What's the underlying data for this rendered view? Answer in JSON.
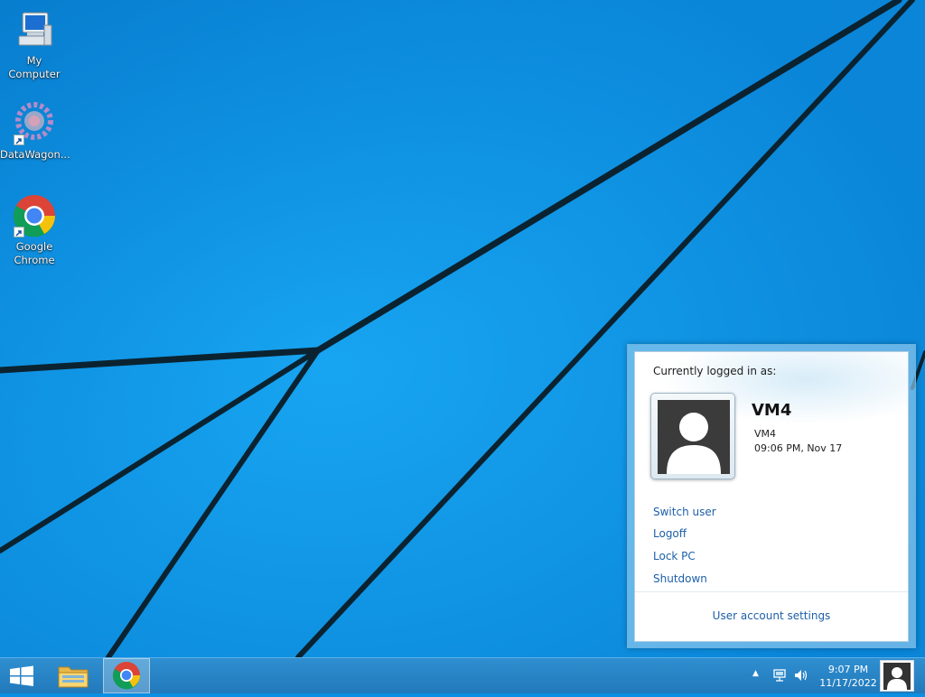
{
  "desktop": {
    "icons": [
      {
        "label": "My Computer",
        "icon": "computer-icon"
      },
      {
        "label": "DataWagon...",
        "icon": "gear-app-icon"
      },
      {
        "label": "Google Chrome",
        "icon": "chrome-icon"
      }
    ]
  },
  "user_popup": {
    "header": "Currently logged in as:",
    "display_name": "VM4",
    "account": "VM4",
    "logon_time": "09:06 PM, Nov 17",
    "avatar_icon": "user-silhouette-icon",
    "links": [
      "Switch user",
      "Logoff",
      "Lock PC",
      "Shutdown"
    ],
    "settings_link": "User account settings"
  },
  "taskbar": {
    "start_icon": "windows-logo-icon",
    "pinned": [
      {
        "name": "File Explorer",
        "icon": "folder-icon"
      },
      {
        "name": "Google Chrome",
        "icon": "chrome-icon",
        "active": true
      }
    ],
    "tray": {
      "chevron": "▲",
      "time": "9:07 PM",
      "date": "11/17/2022"
    }
  },
  "colors": {
    "wallpaper": "#0a8fe3",
    "taskbar": "#2279bb",
    "link": "#1d5fa8"
  }
}
